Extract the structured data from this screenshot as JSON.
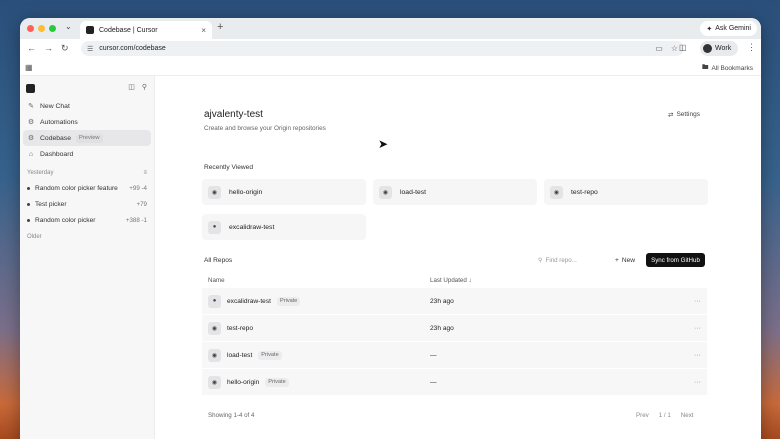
{
  "browser": {
    "tab_menu_icon": "chevron-down-icon",
    "tab_title": "Codebase | Cursor",
    "new_tab": "+",
    "ask_gemini": "Ask Gemini",
    "url": "cursor.com/codebase",
    "profile": "Work",
    "all_bookmarks": "All Bookmarks"
  },
  "sidebar": {
    "nav": [
      {
        "label": "New Chat",
        "icon": "chat-icon"
      },
      {
        "label": "Automations",
        "icon": "automation-icon"
      },
      {
        "label": "Codebase",
        "icon": "codebase-icon",
        "badge": "Preview"
      },
      {
        "label": "Dashboard",
        "icon": "dashboard-icon"
      }
    ],
    "section_yesterday": "Yesterday",
    "chats": [
      {
        "title": "Random color picker feature",
        "diff": "+99 -4"
      },
      {
        "title": "Test picker",
        "diff": "+79"
      },
      {
        "title": "Random color picker",
        "diff": "+388 -1"
      }
    ],
    "section_older": "Older"
  },
  "main": {
    "title": "ajvalenty-test",
    "subtitle": "Create and browse your Origin repositories",
    "settings": "Settings",
    "recently_viewed_label": "Recently Viewed",
    "recent": [
      "hello-origin",
      "load-test",
      "test-repo",
      "excalidraw-test"
    ],
    "all_repos_label": "All Repos",
    "find_placeholder": "Find repo...",
    "new_label": "New",
    "sync_label": "Sync from GitHub",
    "columns": {
      "name": "Name",
      "updated": "Last Updated ↓"
    },
    "rows": [
      {
        "name": "excalidraw-test",
        "tag": "Private",
        "updated": "23h ago",
        "icon": "github-icon"
      },
      {
        "name": "test-repo",
        "tag": "",
        "updated": "23h ago",
        "icon": "origin-icon"
      },
      {
        "name": "load-test",
        "tag": "Private",
        "updated": "—",
        "icon": "origin-icon"
      },
      {
        "name": "hello-origin",
        "tag": "Private",
        "updated": "—",
        "icon": "origin-icon"
      }
    ],
    "more": "···",
    "showing": "Showing 1-4 of 4",
    "pager": {
      "prev": "Prev",
      "page": "1 / 1",
      "next": "Next"
    }
  }
}
